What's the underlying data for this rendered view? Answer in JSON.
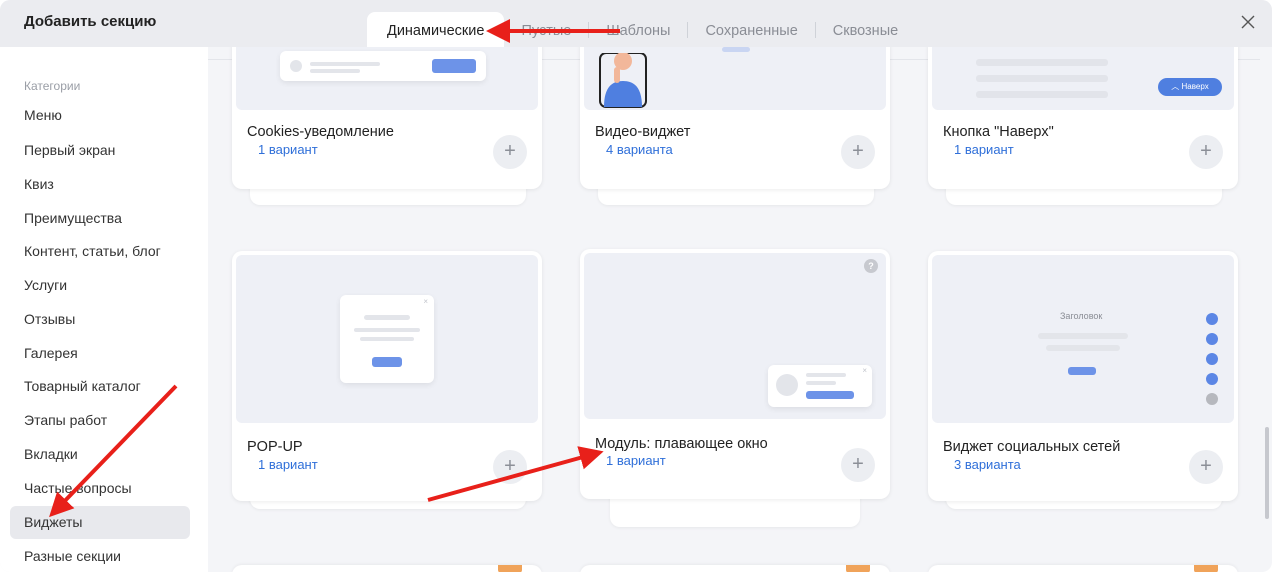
{
  "dialog": {
    "title": "Добавить секцию",
    "close_icon": "close-icon"
  },
  "tabs": [
    {
      "label": "Динамические",
      "active": true
    },
    {
      "label": "Пустые",
      "active": false
    },
    {
      "label": "Шаблоны",
      "active": false
    },
    {
      "label": "Сохраненные",
      "active": false
    },
    {
      "label": "Сквозные",
      "active": false
    }
  ],
  "sidebar": {
    "heading": "Категории",
    "items": [
      {
        "label": "Меню"
      },
      {
        "label": "Первый экран"
      },
      {
        "label": "Квиз"
      },
      {
        "label": "Преимущества"
      },
      {
        "label": "Контент, статьи, блог"
      },
      {
        "label": "Услуги"
      },
      {
        "label": "Отзывы"
      },
      {
        "label": "Галерея"
      },
      {
        "label": "Товарный каталог"
      },
      {
        "label": "Этапы работ"
      },
      {
        "label": "Вкладки"
      },
      {
        "label": "Частые вопросы"
      },
      {
        "label": "Виджеты",
        "active": true
      },
      {
        "label": "Разные секции"
      }
    ]
  },
  "cards": [
    {
      "title": "Cookies-уведомление",
      "variants": "1 вариант",
      "add_label": "+"
    },
    {
      "title": "Видео-виджет",
      "variants": "4 варианта",
      "add_label": "+"
    },
    {
      "title": "Кнопка \"Наверх\"",
      "variants": "1 вариант",
      "add_label": "+",
      "preview_button": "Наверх"
    },
    {
      "title": "POP-UP",
      "variants": "1 вариант",
      "add_label": "+"
    },
    {
      "title": "Модуль: плавающее окно",
      "variants": "1 вариант",
      "add_label": "+",
      "help_label": "?"
    },
    {
      "title": "Виджет социальных сетей",
      "variants": "3 варианта",
      "add_label": "+",
      "preview_heading": "Заголовок"
    }
  ],
  "colors": {
    "accent": "#2f6fd9",
    "annotation": "#e8201a",
    "preview_blue": "#6d93e8"
  }
}
